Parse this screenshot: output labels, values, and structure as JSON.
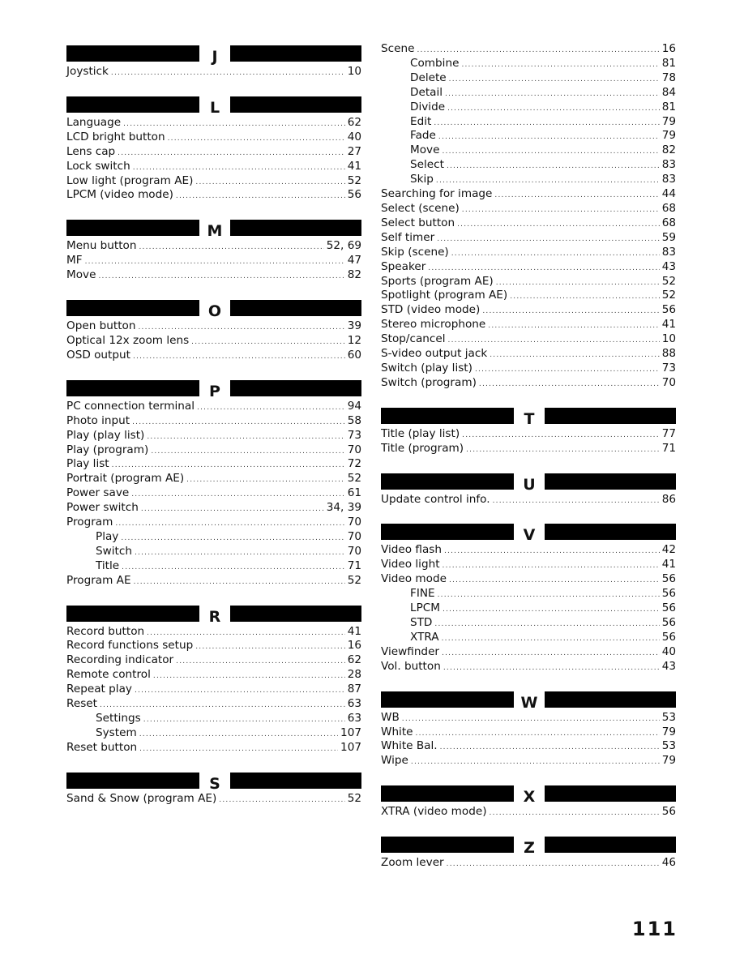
{
  "page_number": "111",
  "left_column": [
    {
      "letter": "J",
      "entries": [
        {
          "label": "Joystick",
          "page": "10",
          "sub": false
        }
      ]
    },
    {
      "letter": "L",
      "entries": [
        {
          "label": "Language",
          "page": "62",
          "sub": false
        },
        {
          "label": "LCD bright button",
          "page": "40",
          "sub": false
        },
        {
          "label": "Lens cap",
          "page": "27",
          "sub": false
        },
        {
          "label": "Lock switch",
          "page": "41",
          "sub": false
        },
        {
          "label": "Low light (program AE)",
          "page": "52",
          "sub": false
        },
        {
          "label": "LPCM (video mode)",
          "page": "56",
          "sub": false
        }
      ]
    },
    {
      "letter": "M",
      "entries": [
        {
          "label": "Menu button",
          "page": "52, 69",
          "sub": false
        },
        {
          "label": "MF",
          "page": "47",
          "sub": false
        },
        {
          "label": "Move",
          "page": "82",
          "sub": false
        }
      ]
    },
    {
      "letter": "O",
      "entries": [
        {
          "label": "Open button",
          "page": "39",
          "sub": false
        },
        {
          "label": "Optical 12x zoom lens",
          "page": "12",
          "sub": false
        },
        {
          "label": "OSD output",
          "page": "60",
          "sub": false
        }
      ]
    },
    {
      "letter": "P",
      "entries": [
        {
          "label": "PC connection terminal",
          "page": "94",
          "sub": false
        },
        {
          "label": "Photo input",
          "page": "58",
          "sub": false
        },
        {
          "label": "Play (play list)",
          "page": "73",
          "sub": false
        },
        {
          "label": "Play (program)",
          "page": "70",
          "sub": false
        },
        {
          "label": "Play list",
          "page": "72",
          "sub": false
        },
        {
          "label": "Portrait (program AE)",
          "page": "52",
          "sub": false
        },
        {
          "label": "Power save",
          "page": "61",
          "sub": false
        },
        {
          "label": "Power switch",
          "page": "34, 39",
          "sub": false
        },
        {
          "label": "Program",
          "page": "70",
          "sub": false
        },
        {
          "label": "Play",
          "page": "70",
          "sub": true
        },
        {
          "label": "Switch",
          "page": "70",
          "sub": true
        },
        {
          "label": "Title",
          "page": "71",
          "sub": true
        },
        {
          "label": "Program AE",
          "page": "52",
          "sub": false
        }
      ]
    },
    {
      "letter": "R",
      "entries": [
        {
          "label": "Record button",
          "page": "41",
          "sub": false
        },
        {
          "label": "Record functions setup",
          "page": "16",
          "sub": false
        },
        {
          "label": "Recording indicator",
          "page": "62",
          "sub": false
        },
        {
          "label": "Remote control",
          "page": "28",
          "sub": false
        },
        {
          "label": "Repeat play",
          "page": "87",
          "sub": false
        },
        {
          "label": "Reset",
          "page": "63",
          "sub": false
        },
        {
          "label": "Settings",
          "page": "63",
          "sub": true
        },
        {
          "label": "System",
          "page": "107",
          "sub": true
        },
        {
          "label": "Reset button",
          "page": "107",
          "sub": false
        }
      ]
    },
    {
      "letter": "S",
      "entries": [
        {
          "label": "Sand & Snow (program AE)",
          "page": "52",
          "sub": false
        }
      ]
    }
  ],
  "right_column": [
    {
      "letter": null,
      "entries": [
        {
          "label": "Scene",
          "page": "16",
          "sub": false
        },
        {
          "label": "Combine",
          "page": "81",
          "sub": true
        },
        {
          "label": "Delete",
          "page": "78",
          "sub": true
        },
        {
          "label": "Detail",
          "page": "84",
          "sub": true
        },
        {
          "label": "Divide",
          "page": "81",
          "sub": true
        },
        {
          "label": "Edit",
          "page": "79",
          "sub": true
        },
        {
          "label": "Fade",
          "page": "79",
          "sub": true
        },
        {
          "label": "Move",
          "page": "82",
          "sub": true
        },
        {
          "label": "Select",
          "page": "83",
          "sub": true
        },
        {
          "label": "Skip",
          "page": "83",
          "sub": true
        },
        {
          "label": "Searching for image",
          "page": "44",
          "sub": false
        },
        {
          "label": "Select (scene)",
          "page": "68",
          "sub": false
        },
        {
          "label": "Select button",
          "page": "68",
          "sub": false
        },
        {
          "label": "Self timer",
          "page": "59",
          "sub": false
        },
        {
          "label": "Skip (scene)",
          "page": "83",
          "sub": false
        },
        {
          "label": "Speaker",
          "page": "43",
          "sub": false
        },
        {
          "label": "Sports (program AE)",
          "page": "52",
          "sub": false
        },
        {
          "label": "Spotlight (program AE)",
          "page": "52",
          "sub": false
        },
        {
          "label": "STD (video mode)",
          "page": "56",
          "sub": false
        },
        {
          "label": "Stereo microphone",
          "page": "41",
          "sub": false
        },
        {
          "label": "Stop/cancel",
          "page": "10",
          "sub": false
        },
        {
          "label": "S-video output jack",
          "page": "88",
          "sub": false
        },
        {
          "label": "Switch (play list)",
          "page": "73",
          "sub": false
        },
        {
          "label": "Switch (program)",
          "page": "70",
          "sub": false
        }
      ]
    },
    {
      "letter": "T",
      "entries": [
        {
          "label": "Title (play list)",
          "page": "77",
          "sub": false
        },
        {
          "label": "Title (program)",
          "page": "71",
          "sub": false
        }
      ]
    },
    {
      "letter": "U",
      "entries": [
        {
          "label": "Update control info.",
          "page": "86",
          "sub": false
        }
      ]
    },
    {
      "letter": "V",
      "entries": [
        {
          "label": "Video flash",
          "page": "42",
          "sub": false
        },
        {
          "label": "Video light",
          "page": "41",
          "sub": false
        },
        {
          "label": "Video mode",
          "page": "56",
          "sub": false
        },
        {
          "label": "FINE",
          "page": "56",
          "sub": true
        },
        {
          "label": "LPCM",
          "page": "56",
          "sub": true
        },
        {
          "label": "STD",
          "page": "56",
          "sub": true
        },
        {
          "label": "XTRA",
          "page": "56",
          "sub": true
        },
        {
          "label": "Viewfinder",
          "page": "40",
          "sub": false
        },
        {
          "label": "Vol. button",
          "page": "43",
          "sub": false
        }
      ]
    },
    {
      "letter": "W",
      "entries": [
        {
          "label": "WB",
          "page": "53",
          "sub": false
        },
        {
          "label": "White",
          "page": "79",
          "sub": false
        },
        {
          "label": "White Bal.",
          "page": "53",
          "sub": false
        },
        {
          "label": "Wipe",
          "page": "79",
          "sub": false
        }
      ]
    },
    {
      "letter": "X",
      "entries": [
        {
          "label": "XTRA (video mode)",
          "page": "56",
          "sub": false
        }
      ]
    },
    {
      "letter": "Z",
      "entries": [
        {
          "label": "Zoom lever",
          "page": "46",
          "sub": false
        }
      ]
    }
  ]
}
